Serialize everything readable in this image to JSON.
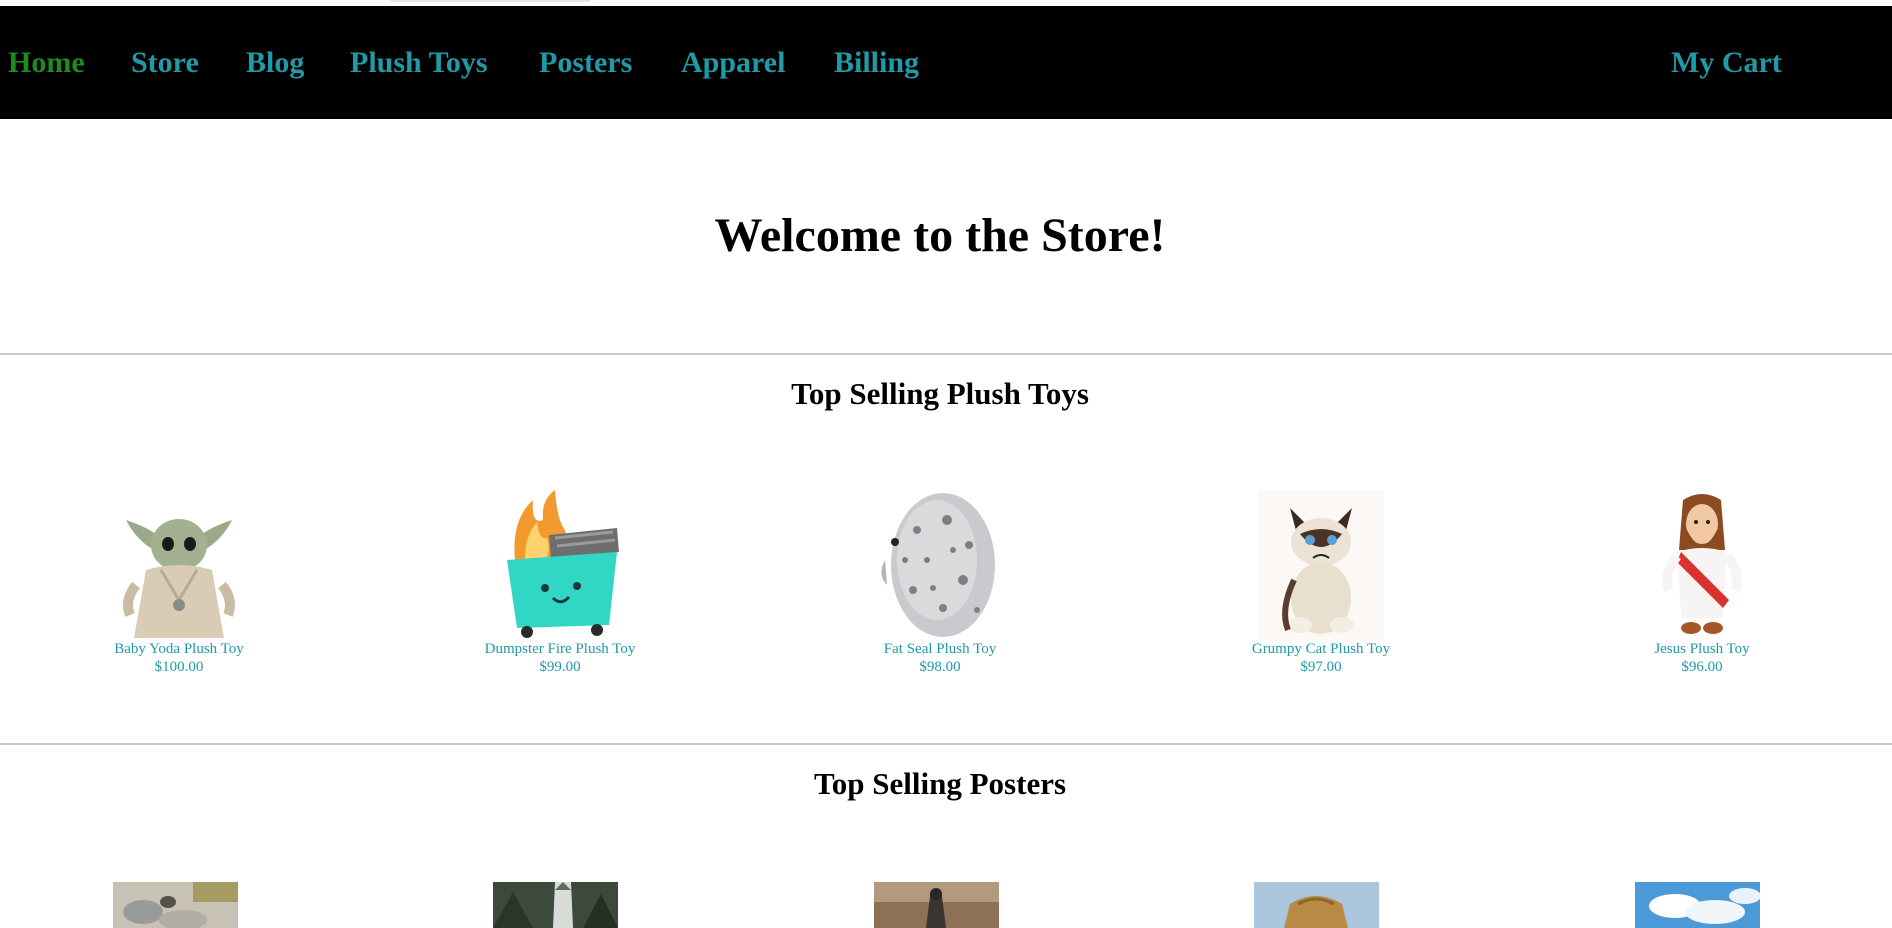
{
  "nav": {
    "items": [
      {
        "label": "Home",
        "active": true
      },
      {
        "label": "Store"
      },
      {
        "label": "Blog"
      },
      {
        "label": "Plush Toys"
      },
      {
        "label": "Posters"
      },
      {
        "label": "Apparel"
      },
      {
        "label": "Billing"
      }
    ],
    "cart_label": "My Cart"
  },
  "hero": {
    "title": "Welcome to the Store!"
  },
  "sections": {
    "plush": {
      "title": "Top Selling Plush Toys",
      "items": [
        {
          "name": "Baby Yoda Plush Toy",
          "price": "$100.00",
          "icon": "baby-yoda-image"
        },
        {
          "name": "Dumpster Fire Plush Toy",
          "price": "$99.00",
          "icon": "dumpster-fire-image"
        },
        {
          "name": "Fat Seal Plush Toy",
          "price": "$98.00",
          "icon": "fat-seal-image"
        },
        {
          "name": "Grumpy Cat Plush Toy",
          "price": "$97.00",
          "icon": "grumpy-cat-image"
        },
        {
          "name": "Jesus Plush Toy",
          "price": "$96.00",
          "icon": "jesus-plush-image"
        }
      ]
    },
    "posters": {
      "title": "Top Selling Posters"
    }
  },
  "colors": {
    "nav_bg": "#000000",
    "link": "#1f9aa6",
    "active_link": "#1f8a1f"
  }
}
